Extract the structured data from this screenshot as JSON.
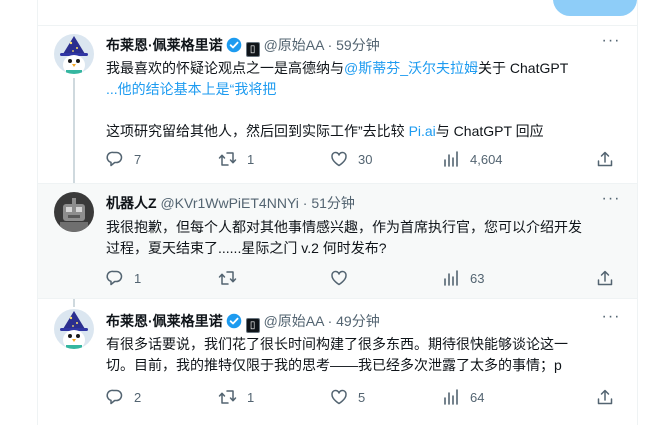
{
  "top": {
    "reply_button_label": ""
  },
  "tweets": [
    {
      "name": "布莱恩·佩莱格里诺",
      "handle": "@原始AA",
      "time": "59分钟",
      "text_l1_a": "我最喜欢的怀疑论观点之一是高德纳与",
      "text_l1_link": "@斯蒂芬_沃尔夫拉姆",
      "text_l1_b": "关于 ChatGPT",
      "text_l2_link": "...他的结论基本上是“我将把",
      "text_l4_a": "这项研究留给其他人，然后回到实际工作”去比较 ",
      "text_l4_link": "Pi.ai",
      "text_l4_b": "与 ChatGPT 回应",
      "replies": "7",
      "retweets": "1",
      "likes": "30",
      "views": "4,604"
    },
    {
      "name": "机器人Z",
      "handle": "@KVr1WwPiET4NNYi",
      "time": "51分钟",
      "text_l1": "我很抱歉，但每个人都对其他事情感兴趣，作为首席执行官，您可以介绍开发",
      "text_l2": "过程，夏天结束了......星际之门 v.2 何时发布?",
      "replies": "1",
      "retweets": "",
      "likes": "",
      "views": "63"
    },
    {
      "name": "布莱恩·佩莱格里诺",
      "handle": "@原始AA",
      "time": "49分钟",
      "text_l1": "有很多话要说，我们花了很长时间构建了很多东西。期待很快能够谈论这一",
      "text_l2": "切。目前，我的推特仅限于我的思考——我已经多次泄露了太多的事情；p",
      "replies": "2",
      "retweets": "1",
      "likes": "5",
      "views": "64"
    }
  ],
  "colors": {
    "accent": "#1d9bf0",
    "muted": "#536471",
    "text": "#0f1419",
    "divider": "#eff3f4"
  },
  "icons": [
    "verified-icon",
    "brand-badge-icon",
    "more-icon",
    "reply-icon",
    "retweet-icon",
    "like-icon",
    "views-icon",
    "share-icon"
  ]
}
